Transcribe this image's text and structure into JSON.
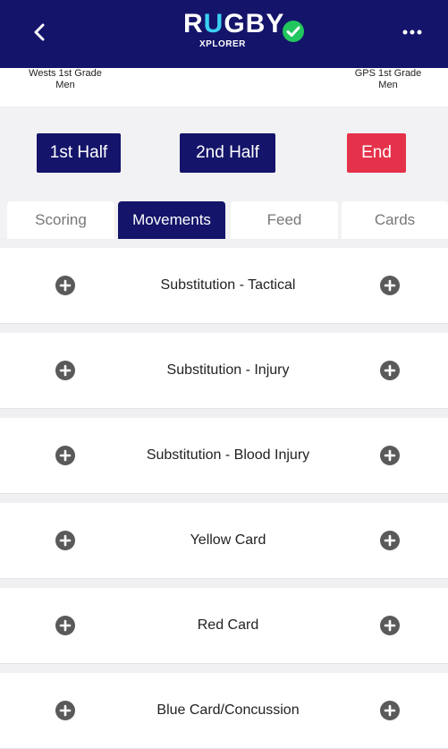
{
  "header": {
    "logo_main_left": "R",
    "logo_main_mid": "U",
    "logo_main_right": "GBY",
    "logo_sub": "XPLORER",
    "colors": {
      "bar": "#14146a",
      "accent": "#3ad0f0",
      "verified": "#22c55e"
    }
  },
  "teams": {
    "home": {
      "name_line1": "Wests 1st Grade",
      "name_line2": "Men"
    },
    "away": {
      "name_line1": "GPS 1st Grade",
      "name_line2": "Men"
    }
  },
  "controls": {
    "first_half": "1st Half",
    "second_half": "2nd Half",
    "end": "End",
    "colors": {
      "primary": "#14146a",
      "end": "#e5324a"
    }
  },
  "tabs": [
    {
      "label": "Scoring",
      "active": false
    },
    {
      "label": "Movements",
      "active": true
    },
    {
      "label": "Feed",
      "active": false
    },
    {
      "label": "Cards",
      "active": false
    }
  ],
  "movements": [
    {
      "label": "Substitution - Tactical"
    },
    {
      "label": "Substitution - Injury"
    },
    {
      "label": "Substitution - Blood Injury"
    },
    {
      "label": "Yellow Card"
    },
    {
      "label": "Red Card"
    },
    {
      "label": "Blue Card/Concussion"
    }
  ]
}
